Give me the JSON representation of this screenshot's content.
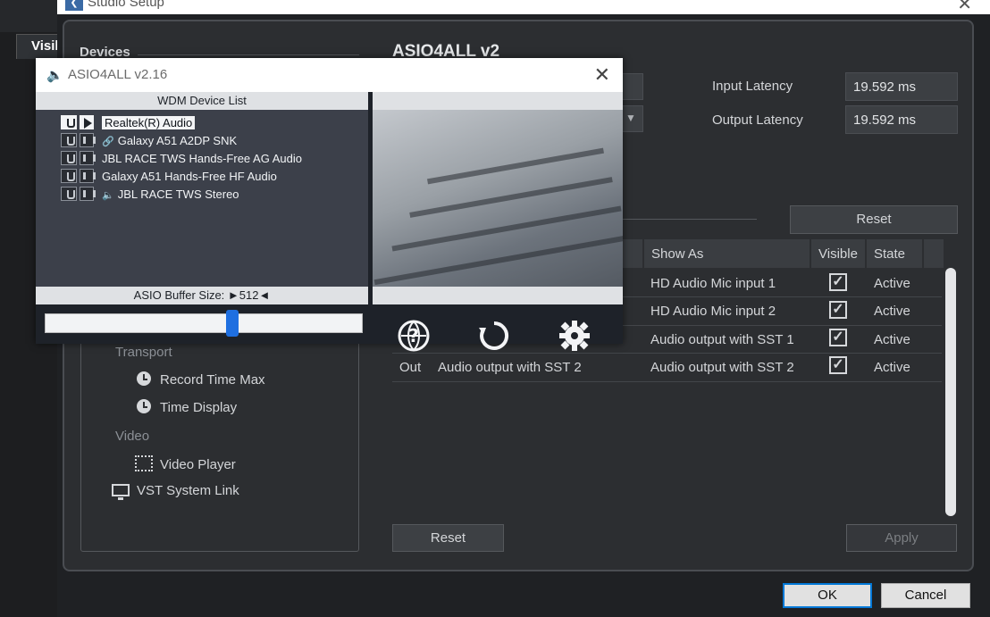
{
  "background_app": {
    "tab_label": "Visil"
  },
  "studio": {
    "title": "Studio Setup",
    "devices_heading": "Devices",
    "tree": [
      {
        "label": "Transport",
        "kind": "category"
      },
      {
        "label": "Record Time Max",
        "kind": "clock"
      },
      {
        "label": "Time Display",
        "kind": "clock"
      },
      {
        "label": "Video",
        "kind": "category"
      },
      {
        "label": "Video Player",
        "kind": "film"
      },
      {
        "label": "VST System Link",
        "kind": "monitor"
      }
    ],
    "device_title": "ASIO4ALL v2",
    "input_latency_label": "Input Latency",
    "input_latency_value": "19.592 ms",
    "output_latency_label": "Output Latency",
    "output_latency_value": "19.592 ms",
    "reset_top": "Reset",
    "table": {
      "headers": [
        "Show As",
        "Visible",
        "State"
      ],
      "rows": [
        {
          "io": "",
          "port": "",
          "show_as": "HD Audio Mic input 1",
          "state": "Active"
        },
        {
          "io": "",
          "port": "",
          "show_as": "HD Audio Mic input 2",
          "state": "Active"
        },
        {
          "io": "",
          "port": "",
          "show_as": "Audio output with SST 1",
          "state": "Active"
        },
        {
          "io": "Out",
          "port": "Audio output with SST 2",
          "show_as": "Audio output with SST 2",
          "state": "Active"
        }
      ]
    },
    "reset_bottom": "Reset",
    "apply": "Apply",
    "ok": "OK",
    "cancel": "Cancel"
  },
  "asio4all": {
    "title": "ASIO4ALL v2.16",
    "wdm_header": "WDM Device List",
    "devices": [
      {
        "label": "Realtek(R) Audio",
        "prefix": "",
        "active": true
      },
      {
        "label": "Galaxy A51 A2DP SNK",
        "prefix": "🔗",
        "active": false
      },
      {
        "label": "JBL RACE TWS Hands-Free AG Audio",
        "prefix": "",
        "active": false
      },
      {
        "label": "Galaxy A51 Hands-Free HF Audio",
        "prefix": "",
        "active": false
      },
      {
        "label": "JBL RACE TWS Stereo",
        "prefix": "🔈",
        "active": false
      }
    ],
    "buffer_label": "ASIO Buffer Size: ►512◄",
    "buffer_fraction": 0.59,
    "icons": [
      "help-globe-icon",
      "reset-arrow-icon",
      "settings-gear-icon"
    ]
  }
}
